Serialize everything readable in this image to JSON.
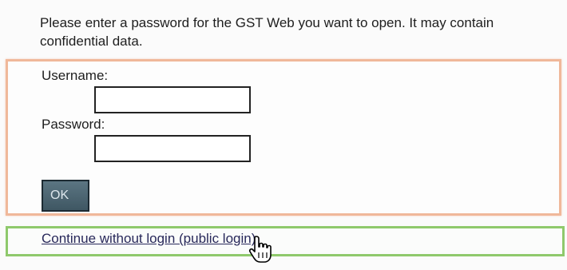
{
  "intro": {
    "text": "Please enter a password for the GST Web you want to open. It may contain confidential data."
  },
  "login_form": {
    "username_label": "Username:",
    "username_value": "",
    "password_label": "Password:",
    "password_value": "",
    "submit_label": "OK"
  },
  "public_login": {
    "link_text": "Continue without login (public login)"
  },
  "cursor": {
    "icon": "hand-pointer-icon"
  },
  "colors": {
    "login_border": "#f0b89a",
    "public_border": "#8fc96c",
    "button_fill": "#4c6571",
    "link_text": "#28285a"
  }
}
